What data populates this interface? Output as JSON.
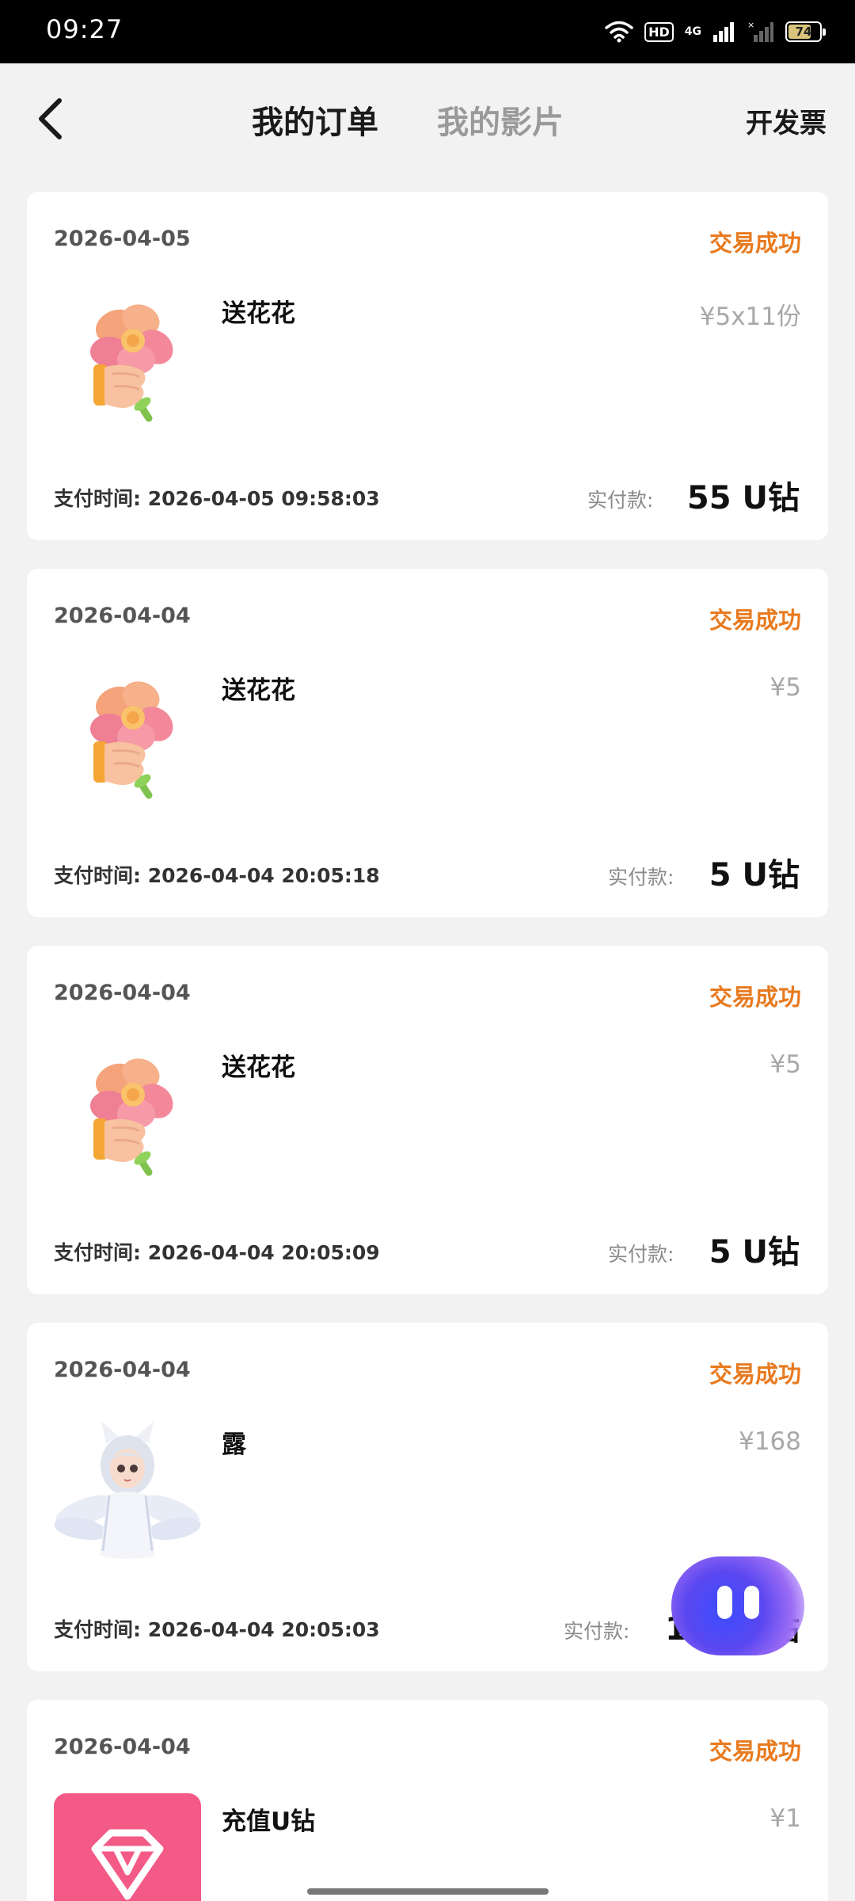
{
  "status_bar": {
    "time": "09:27",
    "network": "4G",
    "battery": "74",
    "battery_level": 0.74,
    "hd": "HD"
  },
  "header": {
    "tab_orders": "我的订单",
    "tab_films": "我的影片",
    "invoice": "开发票"
  },
  "colors": {
    "status_success": "#e87a1f",
    "price_gray": "#a8a8a8",
    "background": "#f2f2f2"
  },
  "orders": [
    {
      "date": "2026-04-05",
      "status": "交易成功",
      "product": "送花花",
      "unit_price": "¥5x11份",
      "pay_time_label": "支付时间:",
      "pay_time": "2026-04-05  09:58:03",
      "paid_label": "实付款:",
      "paid_amount": "55 U钻",
      "icon": "flower-gift-icon"
    },
    {
      "date": "2026-04-04",
      "status": "交易成功",
      "product": "送花花",
      "unit_price": "¥5",
      "pay_time_label": "支付时间:",
      "pay_time": "2026-04-04  20:05:18",
      "paid_label": "实付款:",
      "paid_amount": "5 U钻",
      "icon": "flower-gift-icon"
    },
    {
      "date": "2026-04-04",
      "status": "交易成功",
      "product": "送花花",
      "unit_price": "¥5",
      "pay_time_label": "支付时间:",
      "pay_time": "2026-04-04  20:05:09",
      "paid_label": "实付款:",
      "paid_amount": "5 U钻",
      "icon": "flower-gift-icon"
    },
    {
      "date": "2026-04-04",
      "status": "交易成功",
      "product": "露",
      "unit_price": "¥168",
      "pay_time_label": "支付时间:",
      "pay_time": "2026-04-04  20:05:03",
      "paid_label": "实付款:",
      "paid_amount": "168 U钻",
      "icon": "fox-girl-figure-icon"
    },
    {
      "date": "2026-04-04",
      "status": "交易成功",
      "product": "充值U钻",
      "unit_price": "¥1",
      "icon": "diamond-recharge-icon"
    }
  ]
}
